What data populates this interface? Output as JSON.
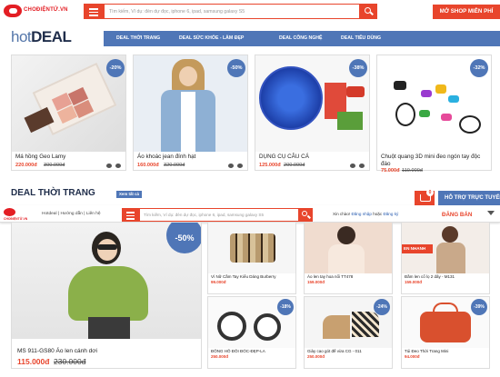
{
  "brand": {
    "logo_text": "CHOĐIỆNTỬ.VN",
    "accent": "#e8452c",
    "nav_blue": "#4f76b7"
  },
  "search": {
    "placeholder": "Tìm kiếm, Ví dụ: đèn dự đọc, iphone 6, ipad, samsung galaxy S5"
  },
  "header": {
    "shop_button": "MỞ SHOP MIỄN PHÍ"
  },
  "hotdeal": {
    "title_light": "hot",
    "title_bold": "DEAL"
  },
  "nav": [
    "DEAL THỜI TRANG",
    "DEAL SỨC KHỎE - LÀM ĐẸP",
    "DEAL CÔNG NGHỆ",
    "DEAL TIÊU DÙNG"
  ],
  "hot_products": [
    {
      "title": "Má hồng Geo Lamy",
      "price": "220.000đ",
      "old": "300.000đ",
      "discount": "-20%"
    },
    {
      "title": "Áo khoác jean đính hạt",
      "price": "160.000đ",
      "old": "320.000đ",
      "discount": "-50%"
    },
    {
      "title": "DỤNG CỤ CÂU CÁ",
      "price": "125.000đ",
      "old": "200.000đ",
      "discount": "-38%"
    },
    {
      "title": "Chuột quang 3D mini đeo ngón tay độc đáo",
      "price": "75.000đ",
      "old": "110.000đ",
      "discount": "-32%"
    }
  ],
  "section": {
    "title": "DEAL THỜI TRANG",
    "see_all": "Xem tất cả"
  },
  "cart": {
    "count": "0"
  },
  "help": {
    "label": "HỖ TRỢ TRỰC TUYẾN"
  },
  "sticky": {
    "links": "Hotdeal | Hướng dẫn | Liên hệ",
    "welcome_prefix": "Xin chào! ",
    "login": "Đăng nhập",
    "or": " hoặc ",
    "register": "Đăng ký",
    "sell": "ĐĂNG BÁN"
  },
  "featured": {
    "title": "MS 911-GS80 Áo len cánh dơi",
    "price": "115.000đ",
    "old": "230.000đ",
    "discount": "-50%"
  },
  "fashion": [
    {
      "title": "Ví Nữ Cầm Tay Kiểu Dáng Burberry",
      "price": "99.000đ",
      "old": "",
      "discount": ""
    },
    {
      "title": "Áo len tay hoa nổi TT478",
      "price": "159.000đ",
      "old": "",
      "discount": ""
    },
    {
      "title": "Đầm len cổ lọ 2 dây - M131",
      "price": "159.000đ",
      "old": "",
      "discount": "",
      "tag": "EN NHANH"
    },
    {
      "title": "ĐỒNG HỒ ĐÔI ĐÓC-ĐẸP-LA",
      "price": "250.000đ",
      "old": "",
      "discount": "-18%"
    },
    {
      "title": "Giày cao gót đế vừa CG - 011",
      "price": "250.000đ",
      "old": "",
      "discount": "-24%"
    },
    {
      "title": "Túi Đeo Thời Trang Mini",
      "price": "94.000đ",
      "old": "",
      "discount": "-39%"
    }
  ]
}
